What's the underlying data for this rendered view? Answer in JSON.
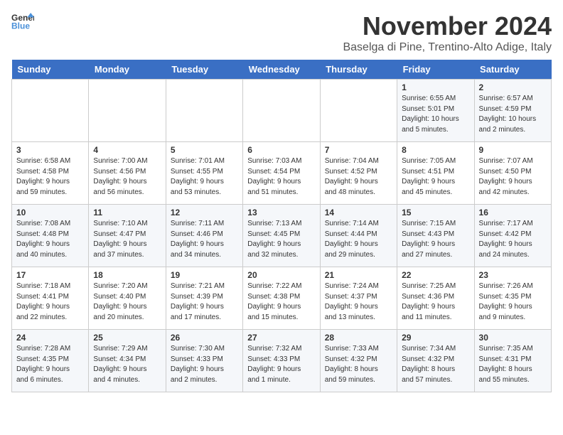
{
  "logo": {
    "general": "General",
    "blue": "Blue"
  },
  "header": {
    "month_title": "November 2024",
    "subtitle": "Baselga di Pine, Trentino-Alto Adige, Italy"
  },
  "days_of_week": [
    "Sunday",
    "Monday",
    "Tuesday",
    "Wednesday",
    "Thursday",
    "Friday",
    "Saturday"
  ],
  "weeks": [
    [
      {
        "day": "",
        "info": ""
      },
      {
        "day": "",
        "info": ""
      },
      {
        "day": "",
        "info": ""
      },
      {
        "day": "",
        "info": ""
      },
      {
        "day": "",
        "info": ""
      },
      {
        "day": "1",
        "info": "Sunrise: 6:55 AM\nSunset: 5:01 PM\nDaylight: 10 hours\nand 5 minutes."
      },
      {
        "day": "2",
        "info": "Sunrise: 6:57 AM\nSunset: 4:59 PM\nDaylight: 10 hours\nand 2 minutes."
      }
    ],
    [
      {
        "day": "3",
        "info": "Sunrise: 6:58 AM\nSunset: 4:58 PM\nDaylight: 9 hours\nand 59 minutes."
      },
      {
        "day": "4",
        "info": "Sunrise: 7:00 AM\nSunset: 4:56 PM\nDaylight: 9 hours\nand 56 minutes."
      },
      {
        "day": "5",
        "info": "Sunrise: 7:01 AM\nSunset: 4:55 PM\nDaylight: 9 hours\nand 53 minutes."
      },
      {
        "day": "6",
        "info": "Sunrise: 7:03 AM\nSunset: 4:54 PM\nDaylight: 9 hours\nand 51 minutes."
      },
      {
        "day": "7",
        "info": "Sunrise: 7:04 AM\nSunset: 4:52 PM\nDaylight: 9 hours\nand 48 minutes."
      },
      {
        "day": "8",
        "info": "Sunrise: 7:05 AM\nSunset: 4:51 PM\nDaylight: 9 hours\nand 45 minutes."
      },
      {
        "day": "9",
        "info": "Sunrise: 7:07 AM\nSunset: 4:50 PM\nDaylight: 9 hours\nand 42 minutes."
      }
    ],
    [
      {
        "day": "10",
        "info": "Sunrise: 7:08 AM\nSunset: 4:48 PM\nDaylight: 9 hours\nand 40 minutes."
      },
      {
        "day": "11",
        "info": "Sunrise: 7:10 AM\nSunset: 4:47 PM\nDaylight: 9 hours\nand 37 minutes."
      },
      {
        "day": "12",
        "info": "Sunrise: 7:11 AM\nSunset: 4:46 PM\nDaylight: 9 hours\nand 34 minutes."
      },
      {
        "day": "13",
        "info": "Sunrise: 7:13 AM\nSunset: 4:45 PM\nDaylight: 9 hours\nand 32 minutes."
      },
      {
        "day": "14",
        "info": "Sunrise: 7:14 AM\nSunset: 4:44 PM\nDaylight: 9 hours\nand 29 minutes."
      },
      {
        "day": "15",
        "info": "Sunrise: 7:15 AM\nSunset: 4:43 PM\nDaylight: 9 hours\nand 27 minutes."
      },
      {
        "day": "16",
        "info": "Sunrise: 7:17 AM\nSunset: 4:42 PM\nDaylight: 9 hours\nand 24 minutes."
      }
    ],
    [
      {
        "day": "17",
        "info": "Sunrise: 7:18 AM\nSunset: 4:41 PM\nDaylight: 9 hours\nand 22 minutes."
      },
      {
        "day": "18",
        "info": "Sunrise: 7:20 AM\nSunset: 4:40 PM\nDaylight: 9 hours\nand 20 minutes."
      },
      {
        "day": "19",
        "info": "Sunrise: 7:21 AM\nSunset: 4:39 PM\nDaylight: 9 hours\nand 17 minutes."
      },
      {
        "day": "20",
        "info": "Sunrise: 7:22 AM\nSunset: 4:38 PM\nDaylight: 9 hours\nand 15 minutes."
      },
      {
        "day": "21",
        "info": "Sunrise: 7:24 AM\nSunset: 4:37 PM\nDaylight: 9 hours\nand 13 minutes."
      },
      {
        "day": "22",
        "info": "Sunrise: 7:25 AM\nSunset: 4:36 PM\nDaylight: 9 hours\nand 11 minutes."
      },
      {
        "day": "23",
        "info": "Sunrise: 7:26 AM\nSunset: 4:35 PM\nDaylight: 9 hours\nand 9 minutes."
      }
    ],
    [
      {
        "day": "24",
        "info": "Sunrise: 7:28 AM\nSunset: 4:35 PM\nDaylight: 9 hours\nand 6 minutes."
      },
      {
        "day": "25",
        "info": "Sunrise: 7:29 AM\nSunset: 4:34 PM\nDaylight: 9 hours\nand 4 minutes."
      },
      {
        "day": "26",
        "info": "Sunrise: 7:30 AM\nSunset: 4:33 PM\nDaylight: 9 hours\nand 2 minutes."
      },
      {
        "day": "27",
        "info": "Sunrise: 7:32 AM\nSunset: 4:33 PM\nDaylight: 9 hours\nand 1 minute."
      },
      {
        "day": "28",
        "info": "Sunrise: 7:33 AM\nSunset: 4:32 PM\nDaylight: 8 hours\nand 59 minutes."
      },
      {
        "day": "29",
        "info": "Sunrise: 7:34 AM\nSunset: 4:32 PM\nDaylight: 8 hours\nand 57 minutes."
      },
      {
        "day": "30",
        "info": "Sunrise: 7:35 AM\nSunset: 4:31 PM\nDaylight: 8 hours\nand 55 minutes."
      }
    ]
  ]
}
